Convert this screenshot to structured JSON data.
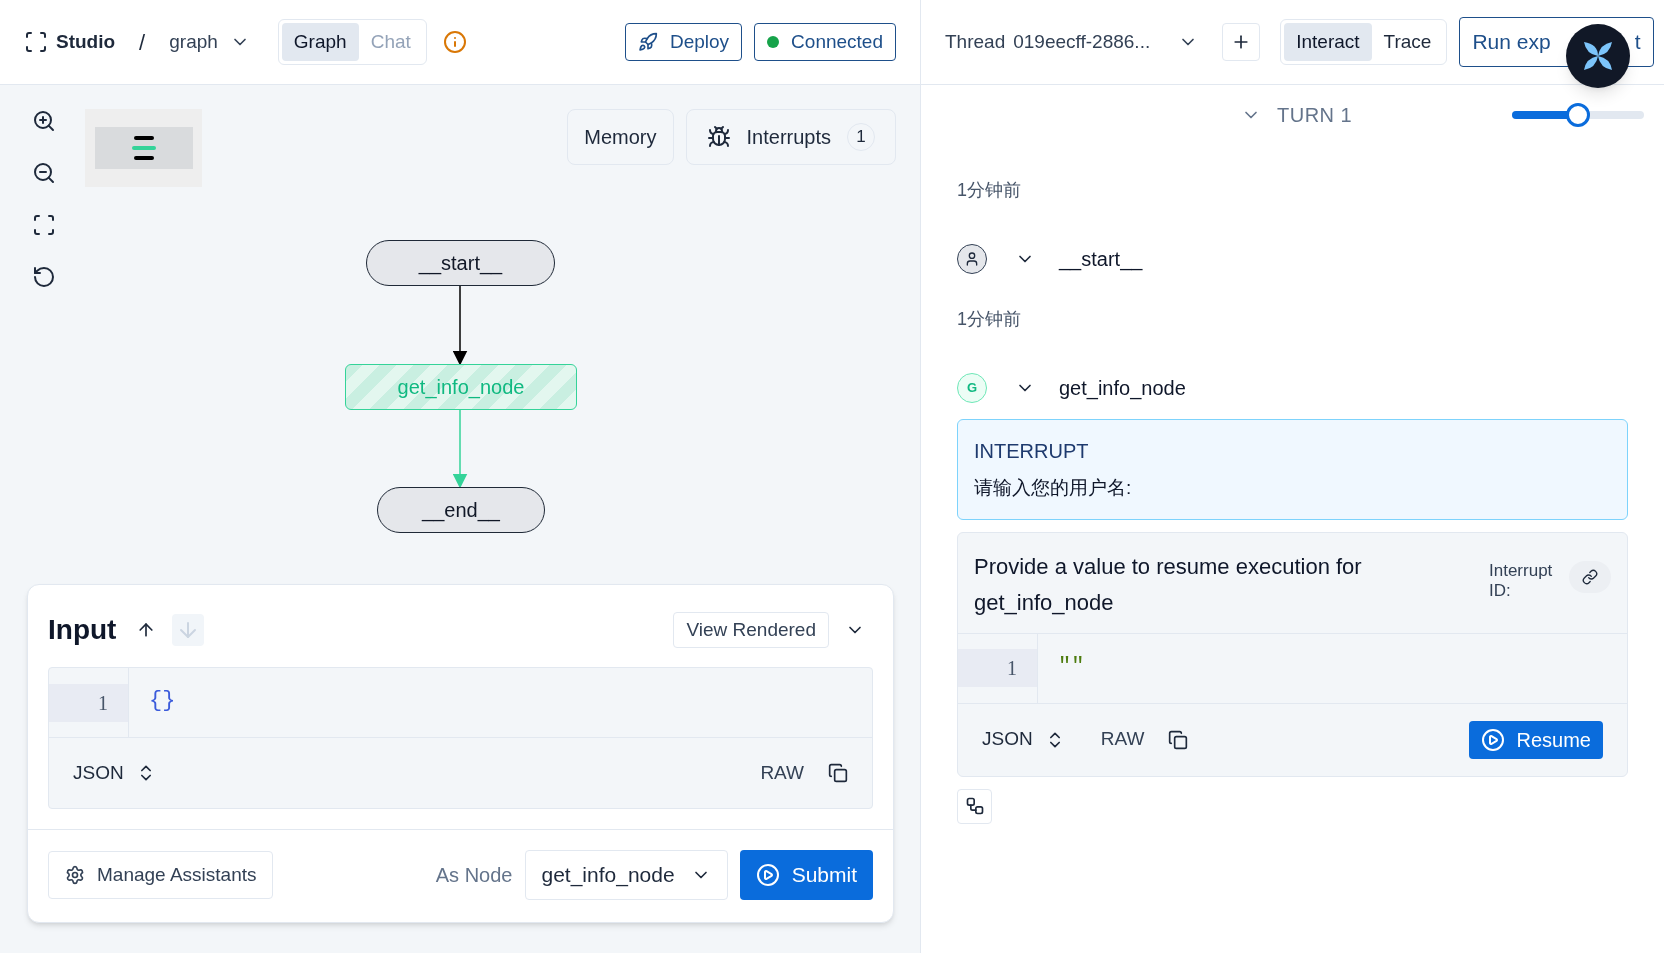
{
  "header": {
    "brand": "Studio",
    "separator": "/",
    "graph_select": "graph",
    "view_tabs": [
      {
        "label": "Graph",
        "selected": true
      },
      {
        "label": "Chat",
        "selected": false
      }
    ],
    "deploy": "Deploy",
    "connection": {
      "label": "Connected",
      "color": "#16a34a"
    }
  },
  "thread": {
    "label": "Thread",
    "value": "019eecff-2886...",
    "tabs": [
      {
        "label": "Interact",
        "selected": true
      },
      {
        "label": "Trace",
        "selected": false
      }
    ],
    "run_button": {
      "start": "Run exp",
      "end": "t"
    }
  },
  "canvas": {
    "memory": "Memory",
    "interrupts": {
      "label": "Interrupts",
      "count": "1"
    },
    "nodes": [
      {
        "label": "__start__",
        "kind": "terminal",
        "active": false
      },
      {
        "label": "get_info_node",
        "kind": "step",
        "active": true
      },
      {
        "label": "__end__",
        "kind": "terminal",
        "active": false
      }
    ]
  },
  "input_panel": {
    "title": "Input",
    "view_mode": "View Rendered",
    "line_number": "1",
    "code": "{}",
    "format": "JSON",
    "raw": "RAW",
    "manage": "Manage Assistants",
    "as_node_label": "As Node",
    "as_node": "get_info_node",
    "submit": "Submit"
  },
  "turn": {
    "label": "TURN 1",
    "slider": {
      "level": 0.5
    }
  },
  "events": [
    {
      "time": "1分钟前",
      "kind": "user",
      "name": "__start__"
    },
    {
      "time": "1分钟前",
      "avatar": "G",
      "kind": "node",
      "name": "get_info_node"
    }
  ],
  "interrupt": {
    "title": "INTERRUPT",
    "message": "请输入您的用户名:"
  },
  "resume": {
    "prompt": "Provide a value to resume execution for get_info_node",
    "id_label": "Interrupt ID:",
    "line_number": "1",
    "code": "\"\"",
    "format": "JSON",
    "raw": "RAW",
    "button": "Resume"
  }
}
